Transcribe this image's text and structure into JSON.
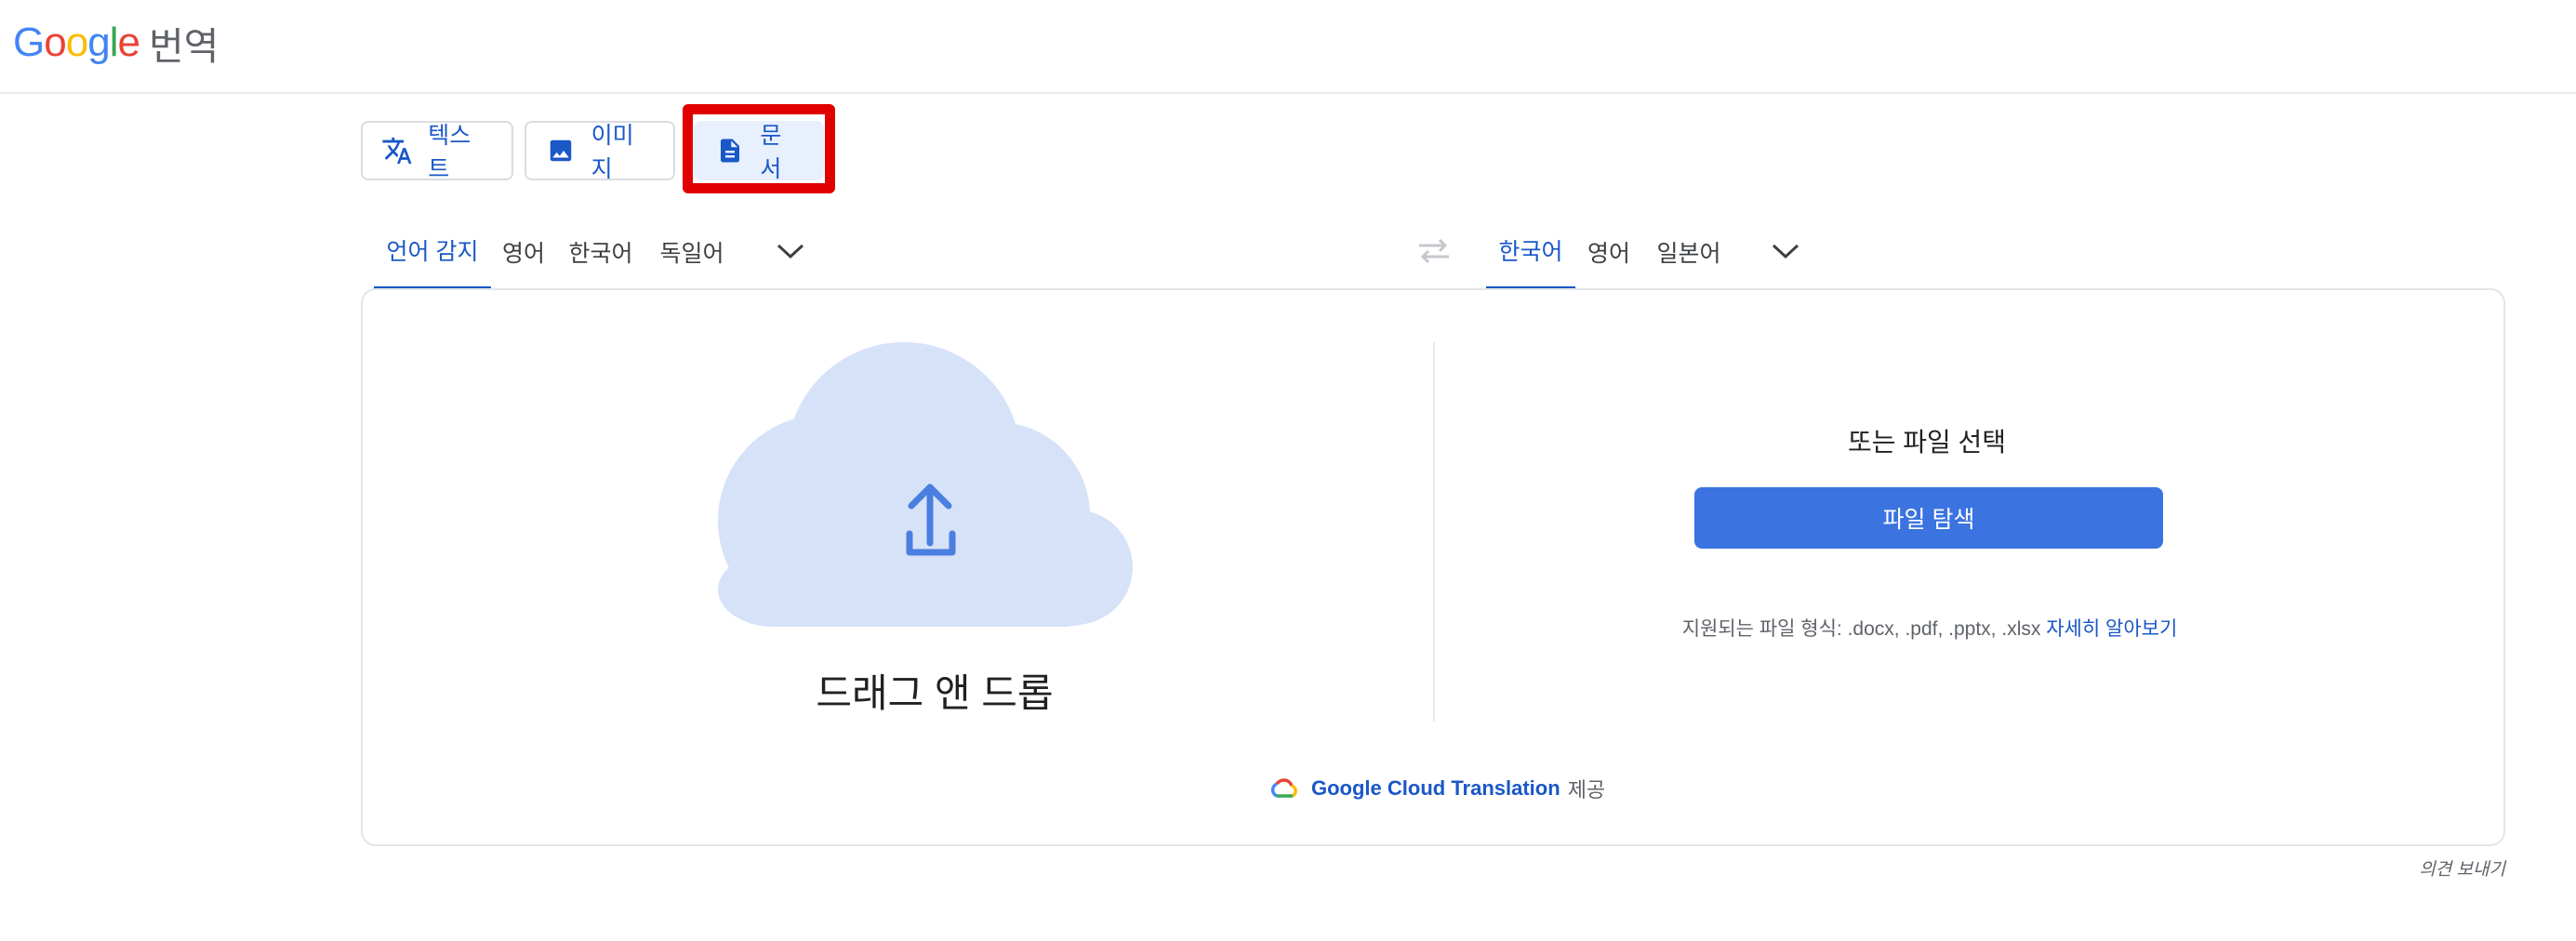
{
  "header": {
    "logo_letters": [
      "G",
      "o",
      "o",
      "g",
      "l",
      "e"
    ],
    "logo_colors": [
      "#4285F4",
      "#EA4335",
      "#FBBC05",
      "#4285F4",
      "#34A853",
      "#EA4335"
    ],
    "product_name": "번역"
  },
  "modes": [
    {
      "label": "텍스트",
      "icon": "translate-icon"
    },
    {
      "label": "이미지",
      "icon": "image-icon"
    },
    {
      "label": "문서",
      "icon": "document-icon",
      "selected": true
    }
  ],
  "source_languages": {
    "tabs": [
      "언어 감지",
      "영어",
      "한국어",
      "독일어"
    ],
    "selected": "언어 감지",
    "more_icon": "chevron-down-icon"
  },
  "swap_icon": "swap-arrows-icon",
  "target_languages": {
    "tabs": [
      "한국어",
      "영어",
      "일본어"
    ],
    "selected": "한국어",
    "more_icon": "chevron-down-icon"
  },
  "upload": {
    "icon": "cloud-upload-icon",
    "drag_drop_text": "드래그 앤 드롭"
  },
  "file_select": {
    "title": "또는 파일 선택",
    "browse_button": "파일 탐색",
    "supported_formats": "지원되는 파일 형식: .docx, .pdf, .pptx, .xlsx",
    "learn_more": "자세히 알아보기"
  },
  "powered_by": {
    "icon": "google-cloud-icon",
    "service": "Google Cloud Translation",
    "suffix": "제공"
  },
  "feedback": "의견 보내기",
  "colors": {
    "accent": "#1a57c7",
    "button": "#3b73e0",
    "cloud": "#d6e2f8",
    "highlight": "#e00000"
  }
}
